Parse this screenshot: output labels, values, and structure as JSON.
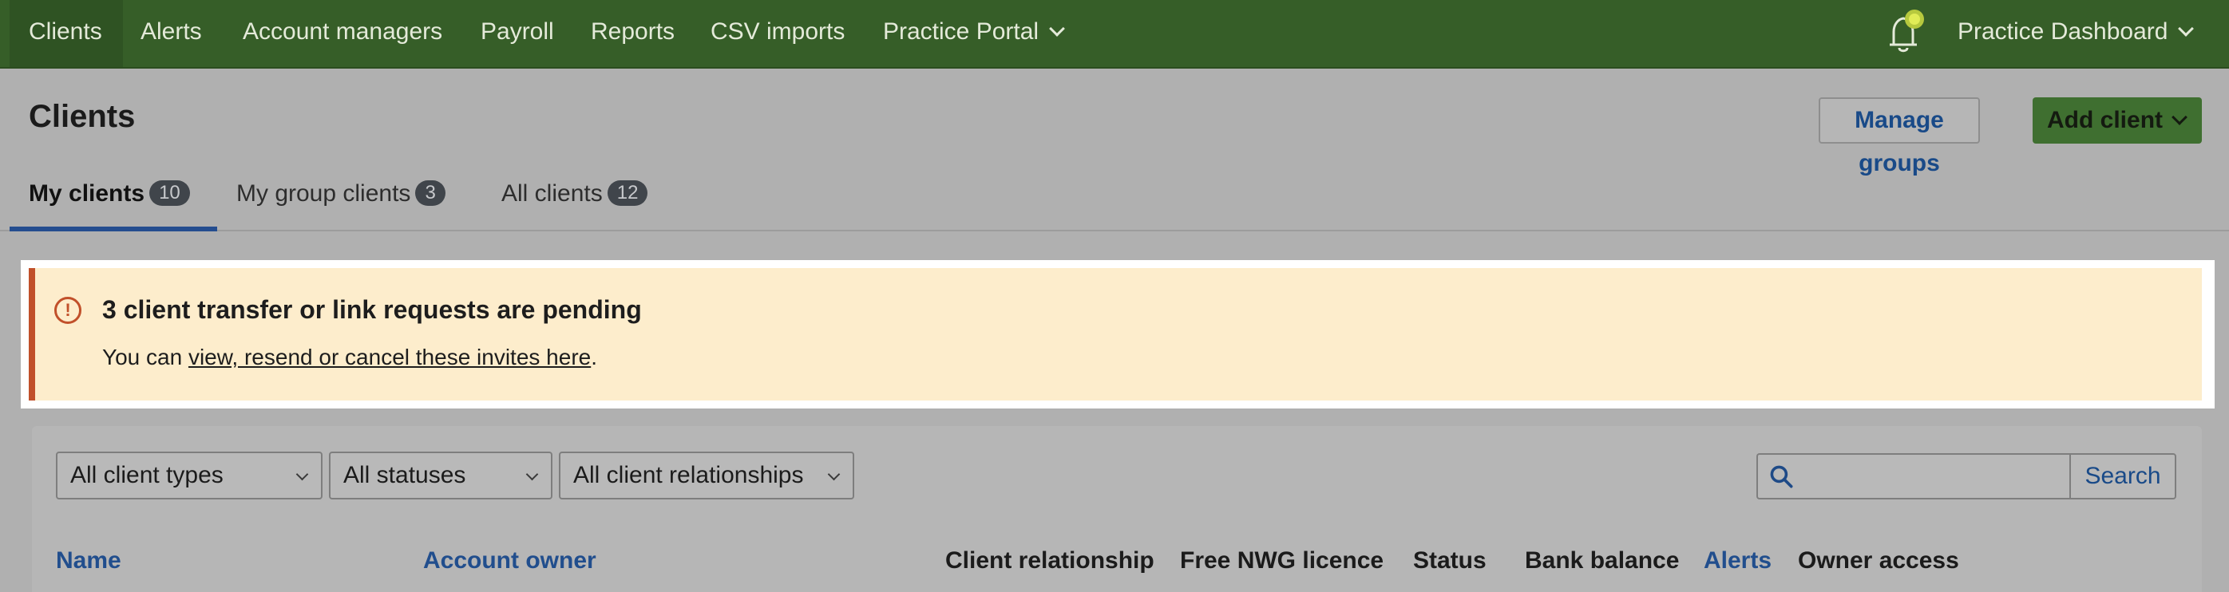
{
  "nav": {
    "items": [
      "Clients",
      "Alerts",
      "Account managers",
      "Payroll",
      "Reports",
      "CSV imports",
      "Practice Portal"
    ],
    "dashboard_label": "Practice Dashboard"
  },
  "header": {
    "title": "Clients",
    "manage_groups": "Manage groups",
    "add_client": "Add client"
  },
  "tabs": [
    {
      "label": "My clients",
      "count": "10"
    },
    {
      "label": "My group clients",
      "count": "3"
    },
    {
      "label": "All clients",
      "count": "12"
    }
  ],
  "banner": {
    "title": "3 client transfer or link requests are pending",
    "text_before": "You can ",
    "link": "view, resend or cancel these invites here",
    "text_after": "."
  },
  "filters": {
    "client_types": "All client types",
    "statuses": "All statuses",
    "relationships": "All client relationships",
    "search_button": "Search",
    "search_value": ""
  },
  "columns": [
    "Name",
    "Account owner",
    "Client relationship",
    "Free NWG licence",
    "Status",
    "Bank balance",
    "Alerts",
    "Owner access"
  ],
  "colors": {
    "nav_bg": "#365e28",
    "banner_accent": "#c1502a",
    "link_blue": "#214e8d",
    "primary_green": "#3f6f30"
  }
}
